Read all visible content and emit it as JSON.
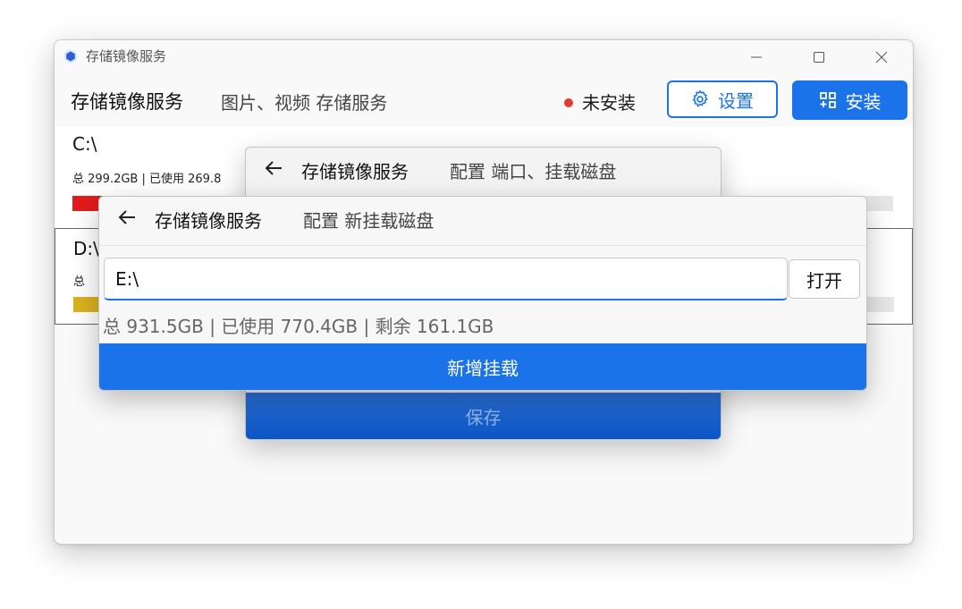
{
  "window": {
    "title": "存储镜像服务"
  },
  "header": {
    "title": "存储镜像服务",
    "subtitle": "图片、视频 存储服务",
    "status_text": "未安装",
    "settings_label": "设置",
    "install_label": "安装"
  },
  "colors": {
    "accent": "#1a73e8",
    "status_red": "#e53935",
    "disk_c_bar": "#e31b1b",
    "disk_d_bar": "#d9b21f"
  },
  "disks": [
    {
      "name": "C:\\",
      "info": "总 299.2GB | 已使用 269.8",
      "used_fraction": 0.9
    },
    {
      "name": "D:\\",
      "info": "总",
      "used_fraction": 0.06
    }
  ],
  "dialog_back": {
    "title": "存储镜像服务",
    "subtitle": "配置 端口、挂载磁盘",
    "save_label": "保存"
  },
  "dialog_front": {
    "title": "存储镜像服务",
    "subtitle": "配置 新挂载磁盘",
    "path_value": "E:\\",
    "open_label": "打开",
    "space_info": "总  931.5GB | 已使用  770.4GB | 剩余  161.1GB",
    "add_label": "新增挂载"
  }
}
